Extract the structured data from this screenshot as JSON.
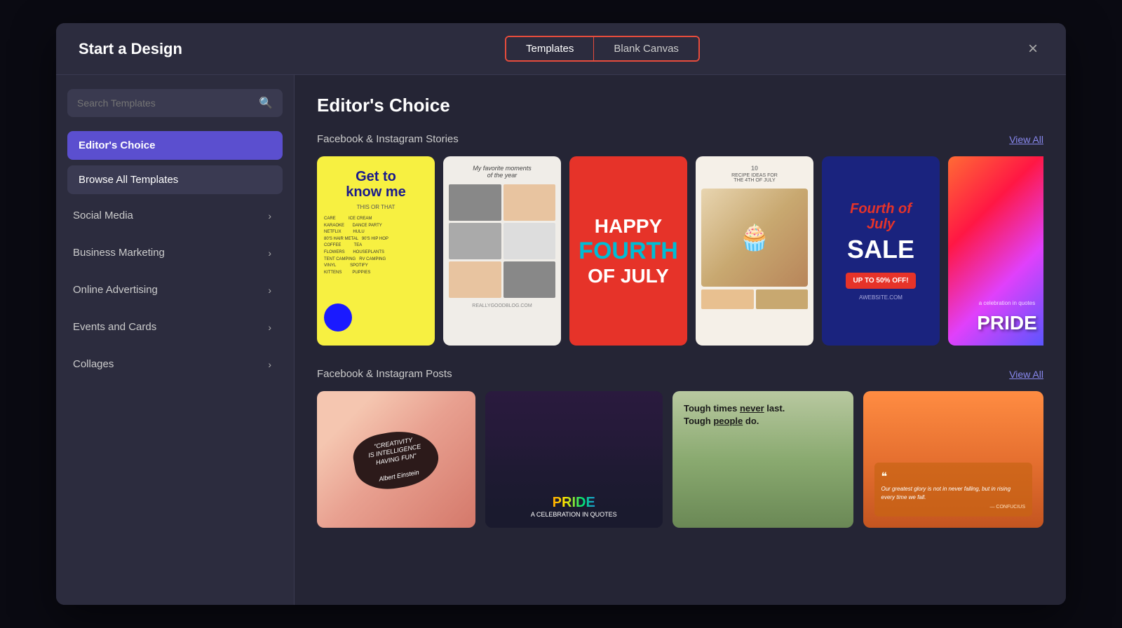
{
  "modal": {
    "title": "Start a Design",
    "close_label": "×"
  },
  "tabs": {
    "templates_label": "Templates",
    "blank_canvas_label": "Blank Canvas"
  },
  "sidebar": {
    "search_placeholder": "Search Templates",
    "items": [
      {
        "id": "editors-choice",
        "label": "Editor's Choice",
        "active": true
      },
      {
        "id": "browse-all",
        "label": "Browse All Templates",
        "active": false
      }
    ],
    "categories": [
      {
        "id": "social-media",
        "label": "Social Media"
      },
      {
        "id": "business-marketing",
        "label": "Business Marketing"
      },
      {
        "id": "online-advertising",
        "label": "Online Advertising"
      },
      {
        "id": "events-and-cards",
        "label": "Events and Cards"
      },
      {
        "id": "collages",
        "label": "Collages"
      }
    ]
  },
  "main": {
    "heading": "Editor's Choice",
    "sections": [
      {
        "id": "fb-ig-stories",
        "title": "Facebook & Instagram Stories",
        "view_all": "View All"
      },
      {
        "id": "fb-ig-posts",
        "title": "Facebook & Instagram Posts",
        "view_all": "View All"
      }
    ]
  },
  "story_cards": [
    {
      "id": "get-to-know",
      "type": "get-to-know",
      "title": "Get to know me",
      "subtitle": "THIS OR THAT"
    },
    {
      "id": "photo-grid",
      "type": "photo-grid",
      "title": "My favorite moments of the year"
    },
    {
      "id": "fourth-july",
      "type": "fourth-july",
      "lines": [
        "HAPPY",
        "FOURTH",
        "OF JULY"
      ]
    },
    {
      "id": "recipe",
      "type": "recipe",
      "title": "10 RECIPE IDEAS FOR THE 4TH OF JULY"
    },
    {
      "id": "fourth-sale",
      "type": "fourth-sale",
      "heading": "Fourth of July",
      "subtext": "SALE",
      "discount": "UP TO 50% OFF!"
    },
    {
      "id": "pride",
      "type": "pride",
      "text": "PRIDE"
    }
  ],
  "post_cards": [
    {
      "id": "creativity",
      "type": "creativity",
      "quote": "\"CREATIVITY IS INTELLIGENCE HAVING FUN\"",
      "author": "Albert Einstein"
    },
    {
      "id": "pride-post",
      "type": "pride-post",
      "text": "PRIDE",
      "subtext": "A CELEBRATION IN QUOTES"
    },
    {
      "id": "tough-times",
      "type": "tough-times",
      "line1": "Tough times never last.",
      "line2": "Tough people do."
    },
    {
      "id": "confucius",
      "type": "confucius",
      "quote": "Our greatest glory is not in never falling, but in rising every time we fall.",
      "author": "— CONFUCIUS"
    }
  ],
  "icons": {
    "search": "🔍",
    "chevron_down": "›",
    "close": "✕"
  }
}
